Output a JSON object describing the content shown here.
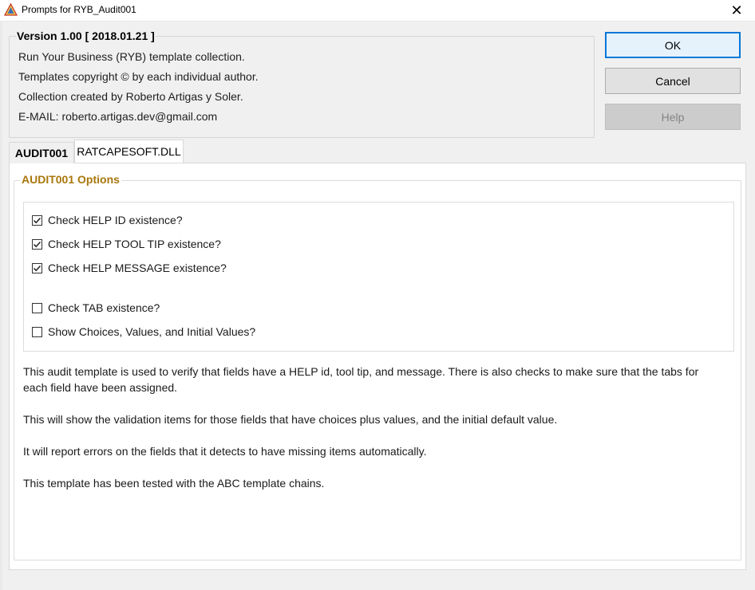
{
  "window": {
    "title": "Prompts for RYB_Audit001",
    "close_glyph": "✕"
  },
  "info": {
    "version": "Version 1.00 [ 2018.01.21 ]",
    "lines": [
      "Run Your Business (RYB) template collection.",
      "Templates copyright © by each individual author.",
      "Collection created by Roberto Artigas y Soler.",
      "E-MAIL: roberto.artigas.dev@gmail.com"
    ]
  },
  "buttons": {
    "ok": "OK",
    "cancel": "Cancel",
    "help": "Help"
  },
  "tabs": [
    {
      "label": "AUDIT001",
      "active": true
    },
    {
      "label": "RATCAPESOFT.DLL",
      "active": false
    }
  ],
  "options": {
    "title": "AUDIT001 Options",
    "checkboxes": [
      {
        "label": "Check HELP ID existence?",
        "checked": true
      },
      {
        "label": "Check HELP TOOL TIP existence?",
        "checked": true
      },
      {
        "label": "Check HELP MESSAGE existence?",
        "checked": true
      },
      {
        "label": "Check TAB existence?",
        "checked": false
      },
      {
        "label": "Show Choices, Values, and Initial Values?",
        "checked": false
      }
    ]
  },
  "description": [
    "This audit template is used to verify that fields have a HELP id, tool tip, and message. There is also checks to make sure that the tabs for each field have been assigned.",
    "This will show the validation items for those fields that have choices plus values, and the initial default value.",
    "It will report errors on the fields that it detects to have missing items automatically.",
    "This template has been tested with the ABC template chains."
  ],
  "colors": {
    "accent": "#0078d7",
    "group_title": "#a8760c"
  },
  "icons": {
    "app": "warning-triangle-icon",
    "check": "checkmark-icon"
  }
}
